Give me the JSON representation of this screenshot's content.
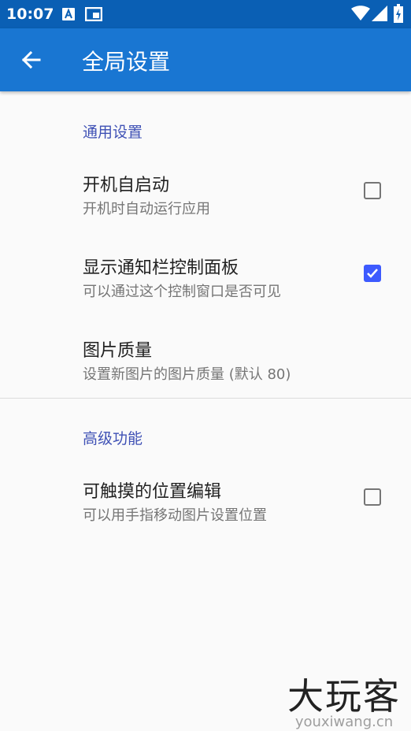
{
  "status_bar": {
    "time": "10:07",
    "icons": [
      "a-notification-icon",
      "cast-icon",
      "wifi-icon",
      "signal-icon",
      "battery-charging-icon"
    ]
  },
  "app_bar": {
    "title": "全局设置",
    "back_icon": "arrow-back-icon",
    "color": "#1976d2"
  },
  "sections": [
    {
      "header": "通用设置",
      "items": [
        {
          "title": "开机自启动",
          "summary": "开机时自动运行应用",
          "checkbox": true,
          "checked": false
        },
        {
          "title": "显示通知栏控制面板",
          "summary": "可以通过这个控制窗口是否可见",
          "checkbox": true,
          "checked": true
        },
        {
          "title": "图片质量",
          "summary": "设置新图片的图片质量 (默认 80)",
          "checkbox": false
        }
      ]
    },
    {
      "header": "高级功能",
      "items": [
        {
          "title": "可触摸的位置编辑",
          "summary": "可以用手指移动图片设置位置",
          "checkbox": true,
          "checked": false
        }
      ]
    }
  ],
  "watermark": {
    "logo": "大玩客",
    "url": "youxiwang.cn"
  },
  "colors": {
    "accent": "#3d5afe",
    "section_header": "#3f51b5",
    "status_bar": "#0a5fb4"
  }
}
